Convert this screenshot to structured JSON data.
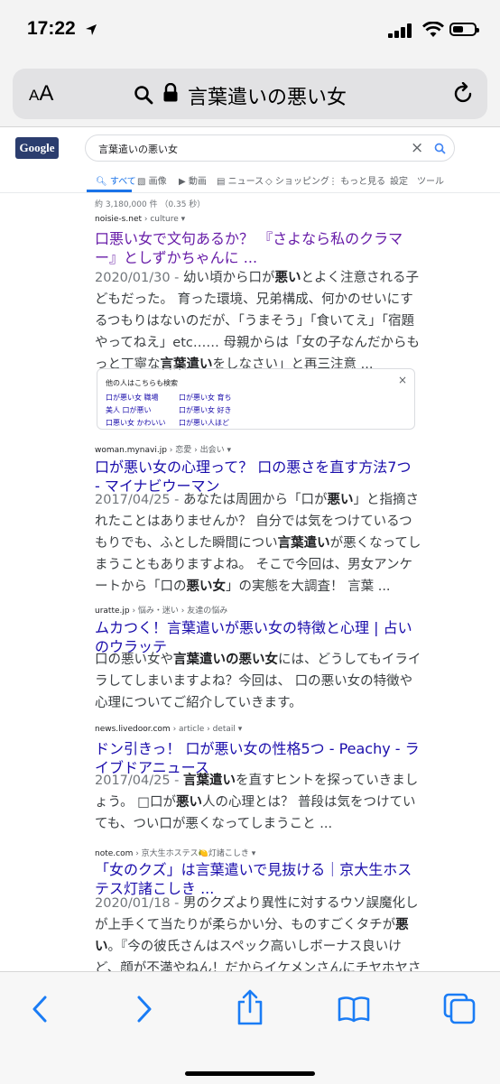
{
  "status": {
    "time": "17:22"
  },
  "address_bar": {
    "aa_small": "A",
    "aa_large": "A",
    "url": "言葉遣いの悪い女"
  },
  "google": {
    "logo": "Google",
    "query": "言葉遣いの悪い女",
    "tabs": [
      "すべて",
      "画像",
      "動画",
      "ニュース",
      "ショッピング",
      "もっと見る",
      "設定",
      "ツール"
    ],
    "result_count": "約 3,180,000 件 （0.35 秒）"
  },
  "results": [
    {
      "site": "noisie-s.net",
      "path": " › culture ▾",
      "title": "口悪い女で文句あるか？ 『さよなら私のクラマー』としずかちゃんに ...",
      "date": "2020/01/30 - ",
      "snippet": [
        {
          "t": "幼い頃から口が"
        },
        {
          "t": "悪い",
          "b": true
        },
        {
          "t": "とよく注意される子どもだった。 育った環境、兄弟構成、何かのせいにするつもりはないのだが、「うまそう」「食いてえ」「宿題やってねえ」etc…… 母親からは「女の子なんだからもっと丁寧な"
        },
        {
          "t": "言葉遣い",
          "b": true
        },
        {
          "t": "をしなさい」と再三注意 ..."
        }
      ]
    },
    {
      "site": "woman.mynavi.jp",
      "path": " › 恋愛 › 出会い ▾",
      "title": "口が悪い女の心理って？ 口の悪さを直す方法7つ - マイナビウーマン",
      "date": "2017/04/25 - ",
      "snippet": [
        {
          "t": "あなたは周囲から「口が"
        },
        {
          "t": "悪い",
          "b": true
        },
        {
          "t": "」と指摘されたことはありませんか？ 自分では気をつけているつもりでも、ふとした瞬間につい"
        },
        {
          "t": "言葉遣い",
          "b": true
        },
        {
          "t": "が悪くなってしまうこともありますよね。 そこで今回は、男女アンケートから「口の"
        },
        {
          "t": "悪い女",
          "b": true
        },
        {
          "t": "」の実態を大調査！ 言葉 ..."
        }
      ]
    },
    {
      "site": "uratte.jp",
      "path": " › 悩み・迷い › 友達の悩み",
      "title": "ムカつく！言葉遣いが悪い女の特徴と心理 | 占いのウラッテ",
      "date": "",
      "snippet": [
        {
          "t": "口の悪い女や"
        },
        {
          "t": "言葉遣いの悪い女",
          "b": true
        },
        {
          "t": "には、どうしてもイライラしてしまいますよね？今回は、 口の悪い女の特徴や心理についてご紹介していきます。"
        }
      ]
    },
    {
      "site": "news.livedoor.com",
      "path": " › article › detail ▾",
      "title": "ドン引きっ！ 口が悪い女の性格5つ - Peachy - ライブドアニュース",
      "date": "2017/04/25 - ",
      "snippet": [
        {
          "t": "言葉遣い",
          "b": true
        },
        {
          "t": "を直すヒントを探っていきましょう。 □口が"
        },
        {
          "t": "悪い",
          "b": true
        },
        {
          "t": "人の心理とは？ 普段は気をつけていても、つい口が悪くなってしまうこと ..."
        }
      ]
    },
    {
      "site": "note.com",
      "path": " › 京大生ホステス🍋灯諸こしき ▾",
      "title": "「女のクズ」は言葉遣いで見抜ける｜京大生ホステス灯諸こしき ...",
      "date": "2020/01/18 - ",
      "snippet": [
        {
          "t": "男のクズより異性に対するウソ誤魔化しが上手くて当たりが柔らかい分、ものすごくタチが"
        },
        {
          "t": "悪い",
          "b": true
        },
        {
          "t": "。『今の彼氏さんはスペック高いしボーナス良いけど、顔が不満やねん！だからイケメンさんにチヤホヤされて心"
        }
      ]
    }
  ],
  "also_searched": {
    "title": "他の人はこちらも検索",
    "close": "×",
    "links": [
      "口が悪い女 職場",
      "口が悪い女 育ち",
      "美人 口が悪い",
      "口が悪い女 好き",
      "口悪い女 かわいい",
      "口が悪い人ほど"
    ]
  },
  "icons": [
    "location-arrow-icon",
    "signal-icon",
    "wifi-icon",
    "battery-icon",
    "search-icon",
    "lock-icon",
    "reload-icon",
    "close-icon",
    "back-icon",
    "forward-icon",
    "share-icon",
    "bookmarks-icon",
    "tabs-icon"
  ]
}
